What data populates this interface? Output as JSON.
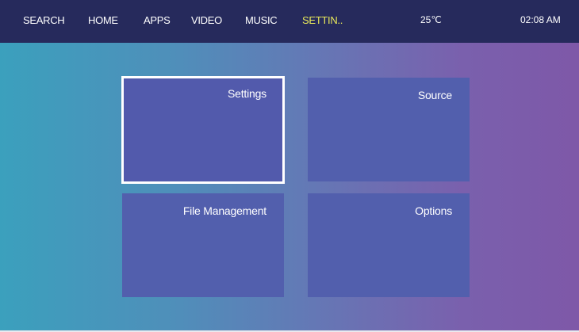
{
  "nav": {
    "items": [
      {
        "label": "SEARCH"
      },
      {
        "label": "HOME"
      },
      {
        "label": "APPS"
      },
      {
        "label": "VIDEO"
      },
      {
        "label": "MUSIC"
      },
      {
        "label": "SETTIN.."
      }
    ],
    "active_item": "SETTIN.."
  },
  "status": {
    "temperature": "25℃",
    "time": "02:08 AM"
  },
  "tiles": [
    {
      "label": "Settings",
      "focused": true
    },
    {
      "label": "Source",
      "focused": false
    },
    {
      "label": "File Management",
      "focused": false
    },
    {
      "label": "Options",
      "focused": false
    }
  ],
  "colors": {
    "topbar": "#262a5c",
    "active_nav": "#e8e85a",
    "tile": "#525fad",
    "focus_border": "#ffffff"
  }
}
